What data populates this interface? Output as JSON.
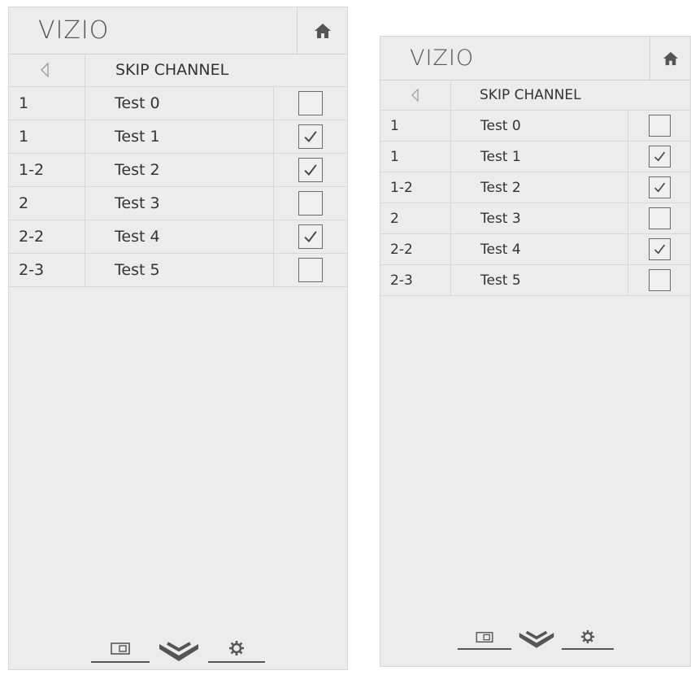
{
  "app": {
    "brand": "VIZIO"
  },
  "menu": {
    "title": "SKIP CHANNEL"
  },
  "channels": [
    {
      "number": "1",
      "name": "Test 0",
      "skipped": false
    },
    {
      "number": "1",
      "name": "Test 1",
      "skipped": true
    },
    {
      "number": "1-2",
      "name": "Test 2",
      "skipped": true
    },
    {
      "number": "2",
      "name": "Test 3",
      "skipped": false
    },
    {
      "number": "2-2",
      "name": "Test 4",
      "skipped": true
    },
    {
      "number": "2-3",
      "name": "Test 5",
      "skipped": false
    }
  ],
  "icons": {
    "home": "home-icon",
    "back": "back-arrow-icon",
    "checked": "checkmark-icon",
    "footer": [
      "input-icon",
      "vizio-v-icon",
      "settings-gear-icon"
    ]
  },
  "colors": {
    "panel_bg": "#ececec",
    "divider": "#d6d6d6",
    "text": "#333333"
  }
}
